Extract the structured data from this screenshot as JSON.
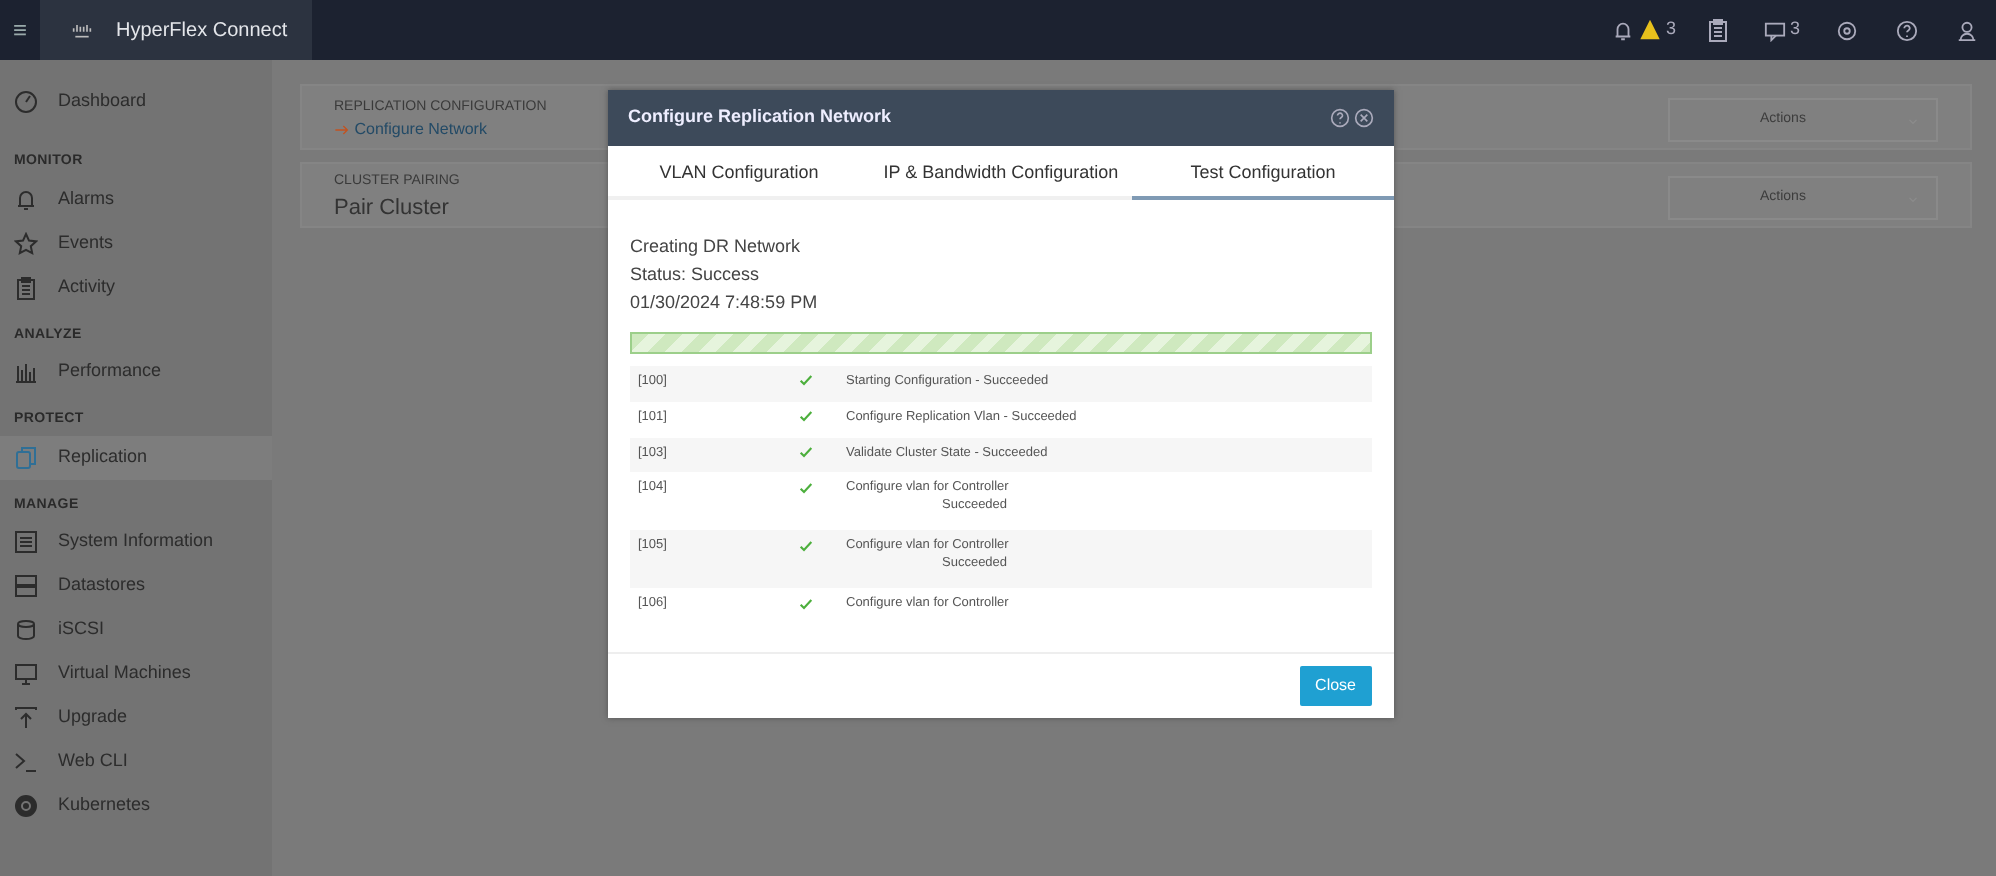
{
  "topbar": {
    "menu_glyph": "≡",
    "brand": "HyperFlex Connect",
    "alerts_count": "3",
    "messages_count": "3"
  },
  "sidebar": {
    "sections": [
      {
        "items": [
          {
            "label": "Dashboard",
            "selected": false
          }
        ]
      },
      {
        "heading": "MONITOR",
        "items": [
          {
            "label": "Alarms",
            "selected": false
          },
          {
            "label": "Events",
            "selected": false
          },
          {
            "label": "Activity",
            "selected": false
          }
        ]
      },
      {
        "heading": "ANALYZE",
        "items": [
          {
            "label": "Performance",
            "selected": false
          }
        ]
      },
      {
        "heading": "PROTECT",
        "items": [
          {
            "label": "Replication",
            "selected": true
          }
        ]
      },
      {
        "heading": "MANAGE",
        "items": [
          {
            "label": "System Information",
            "selected": false
          },
          {
            "label": "Datastores",
            "selected": false
          },
          {
            "label": "iSCSI",
            "selected": false
          },
          {
            "label": "Virtual Machines",
            "selected": false
          },
          {
            "label": "Upgrade",
            "selected": false
          },
          {
            "label": "Web CLI",
            "selected": false
          },
          {
            "label": "Kubernetes",
            "selected": false
          }
        ]
      }
    ]
  },
  "panels": [
    {
      "heading": "REPLICATION CONFIGURATION",
      "kind": "link",
      "value": "Configure Network",
      "action": "Actions"
    },
    {
      "heading": "CLUSTER PAIRING",
      "kind": "title",
      "value": "Pair Cluster",
      "action": "Actions"
    }
  ],
  "dialog": {
    "title": "Configure Replication Network",
    "tabs": [
      {
        "label": "VLAN Configuration",
        "selected": false
      },
      {
        "label": "IP & Bandwidth Configuration",
        "selected": false
      },
      {
        "label": "Test Configuration",
        "selected": true
      }
    ],
    "summary": [
      "Creating DR Network",
      "Status: Success",
      "01/30/2024 7:48:59 PM"
    ],
    "progress": {
      "level": 1
    },
    "log": [
      {
        "code": "[100]",
        "lines": [
          "Starting Configuration - Succeeded"
        ]
      },
      {
        "code": "[101]",
        "lines": [
          "Configure Replication Vlan - Succeeded"
        ]
      },
      {
        "code": "[103]",
        "lines": [
          "Validate Cluster State - Succeeded"
        ]
      },
      {
        "code": "[104]",
        "lines": [
          "Configure vlan for Controller",
          "Succeeded"
        ]
      },
      {
        "code": "[105]",
        "lines": [
          "Configure vlan for Controller",
          "Succeeded"
        ]
      },
      {
        "code": "[106]",
        "lines": [
          "Configure vlan for Controller"
        ]
      }
    ],
    "close_button": "Close"
  }
}
